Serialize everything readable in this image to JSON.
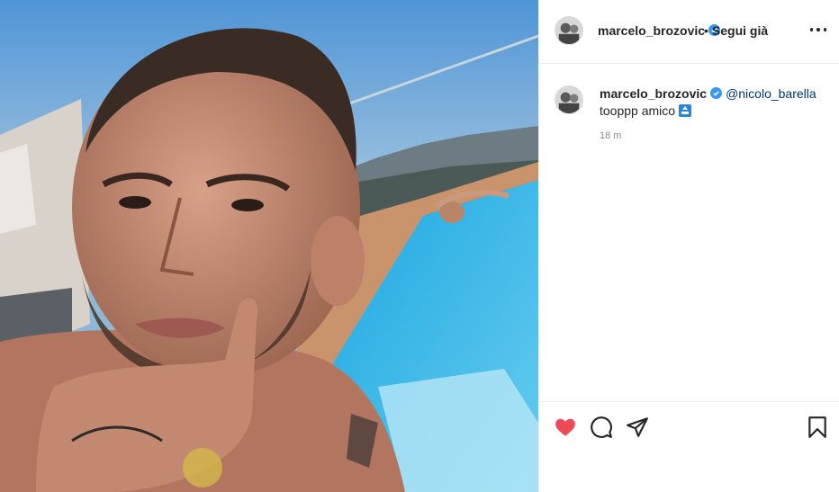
{
  "post": {
    "image_description_name": "pool-selfie-photo"
  },
  "header": {
    "username": "marcelo_brozovic",
    "separator": "•",
    "follow_status": "Segui già"
  },
  "caption": {
    "username": "marcelo_brozovic",
    "mention": "@nicolo_barella",
    "text": "tooppp amico",
    "emoji": "top-arrow-emoji",
    "time": "18 m"
  },
  "icons": {
    "verified": "verified-badge-icon",
    "more": "more-options-icon",
    "like": "heart-icon",
    "comment": "comment-bubble-icon",
    "share": "paper-plane-icon",
    "save": "bookmark-icon"
  },
  "colors": {
    "like": "#ed4956",
    "verified": "#3897f0",
    "mention": "#00376b",
    "muted": "#8e8e8e"
  }
}
